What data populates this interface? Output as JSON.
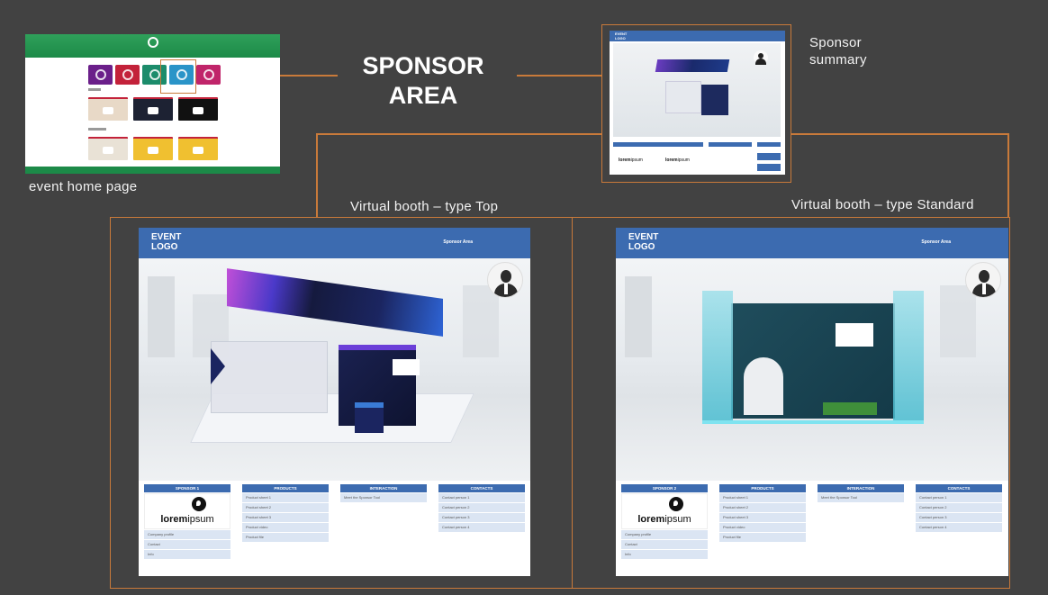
{
  "title": {
    "line1": "SPONSOR",
    "line2": "AREA"
  },
  "captions": {
    "home": "event  home  page",
    "summary_line1": "Sponsor",
    "summary_line2": "summary",
    "booth_top": "Virtual booth – type Top",
    "booth_standard": "Virtual booth – type Standard"
  },
  "home_page": {
    "tiles": [
      {
        "color": "#6b1f8a"
      },
      {
        "color": "#c3223a"
      },
      {
        "color": "#1c8c6b"
      },
      {
        "color": "#2a94c8"
      },
      {
        "color": "#c0256a"
      }
    ],
    "highlighted_tile_index": 3,
    "thumb_colors": [
      "#e8d9c7",
      "#1d2233",
      "#111111",
      "#e9e2d6",
      "#f0c030",
      "#f0c030"
    ]
  },
  "booths": [
    {
      "id": "top",
      "event_logo_line1": "EVENT",
      "event_logo_line2": "LOGO",
      "header_right": "Sponsor Area",
      "sponsor_header": "SPONSOR 1",
      "brand_strong": "lorem",
      "brand_light": "ipsum",
      "sponsor_items": [
        "Company profile",
        "Contact",
        "Info"
      ],
      "products_header": "PRODUCTS",
      "products": [
        "Product sheet 1",
        "Product sheet 2",
        "Product sheet 3",
        "Product video",
        "Product file"
      ],
      "interaction_header": "INTERACTION",
      "interaction": [
        "Meet the Sponsor Tool"
      ],
      "contacts_header": "CONTACTS",
      "contacts": [
        "Contact person 1",
        "Contact person 2",
        "Contact person 3",
        "Contact person 4"
      ]
    },
    {
      "id": "standard",
      "event_logo_line1": "EVENT",
      "event_logo_line2": "LOGO",
      "header_right": "Sponsor Area",
      "sponsor_header": "SPONSOR 2",
      "brand_strong": "lorem",
      "brand_light": "ipsum",
      "sponsor_items": [
        "Company profile",
        "Contact",
        "Info"
      ],
      "products_header": "PRODUCTS",
      "products": [
        "Product sheet 1",
        "Product sheet 2",
        "Product sheet 3",
        "Product video",
        "Product file"
      ],
      "interaction_header": "INTERACTION",
      "interaction": [
        "Meet the Sponsor Tool"
      ],
      "contacts_header": "CONTACTS",
      "contacts": [
        "Contact person 1",
        "Contact person 2",
        "Contact person 3",
        "Contact person 4"
      ]
    }
  ],
  "summary": {
    "event_logo_line1": "EVENT",
    "event_logo_line2": "LOGO",
    "brand_strong": "lorem",
    "brand_light": "ipsum"
  },
  "colors": {
    "background": "#424242",
    "accent_line": "#c97a3a",
    "header_blue": "#3c6bb0",
    "home_green": "#2fa05a"
  }
}
